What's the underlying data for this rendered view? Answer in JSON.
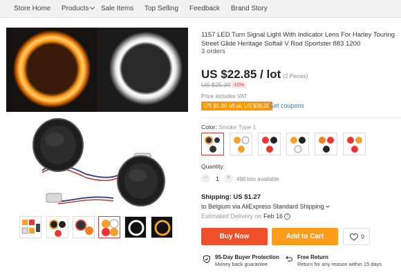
{
  "nav": {
    "items": [
      "Store Home",
      "Products",
      "Sale Items",
      "Top Selling",
      "Feedback",
      "Brand Story"
    ]
  },
  "product": {
    "title": "1157 LED Turn Signal Light With Indicator Lens For Harley Touring Street Glide Heritage Softail V Rod Sportster 883 1200",
    "orders": "3 orders",
    "price": "US $22.85 / lot",
    "pieces": "(2 Pieces)",
    "original_price": "US $25.39",
    "discount": "-10%",
    "vat_note": "Price includes VAT",
    "coupon_badge": "US $1.00 off on US $36.00",
    "get_coupons": "Get coupons",
    "color_label": "Color:",
    "color_value": "Smoke Type 1",
    "quantity_label": "Quantity:",
    "quantity_minus": "−",
    "quantity_plus": "+",
    "quantity": "1",
    "available": "498 lots available",
    "shipping": "Shipping: US $1.27",
    "ship_to": "to Belgium via AliExpress Standard Shipping",
    "delivery_label": "Estimated Delivery on",
    "delivery_date": "Feb 16",
    "buy_now": "Buy Now",
    "add_to_cart": "Add to Cart",
    "wishlist_count": "9"
  },
  "guarantees": [
    {
      "title": "95-Day Buyer Protection",
      "subtitle": "Money back guarantee",
      "icon": "shield-check-icon"
    },
    {
      "title": "Free Return",
      "subtitle": "Return for any reason within 15 days",
      "icon": "return-icon"
    }
  ],
  "colors": {
    "accent_red": "#f04f2c",
    "accent_orange": "#ff9c1a",
    "coupon_orange": "#ff9800",
    "link_blue": "#2b7bd6"
  }
}
